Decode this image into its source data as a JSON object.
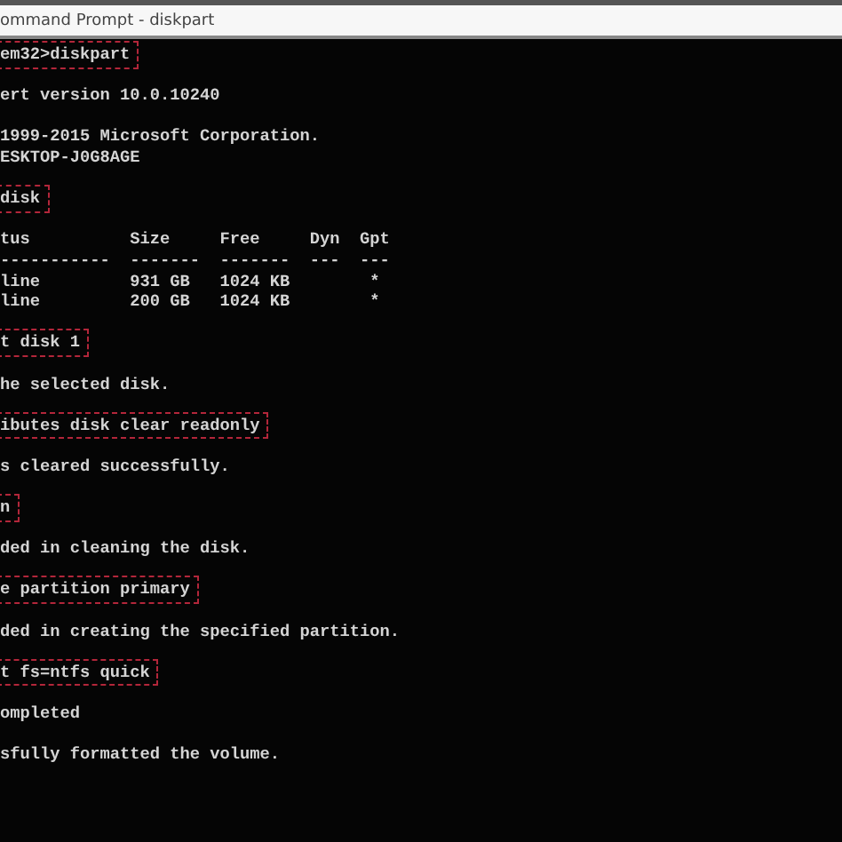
{
  "window": {
    "title": "ommand Prompt - diskpart"
  },
  "console": {
    "blocks": [
      {
        "lines": [
          {
            "kind": "command",
            "text": "em32>diskpart"
          }
        ]
      },
      {
        "lines": [
          {
            "kind": "output",
            "text": "ert version 10.0.10240"
          }
        ]
      },
      {
        "lines": [
          {
            "kind": "output",
            "text": "1999-2015 Microsoft Corporation."
          },
          {
            "kind": "output",
            "text": "ESKTOP-J0G8AGE"
          }
        ]
      },
      {
        "lines": [
          {
            "kind": "command",
            "text": "disk"
          }
        ]
      },
      {
        "lines": [
          {
            "kind": "output",
            "text": "tus          Size     Free     Dyn  Gpt"
          },
          {
            "kind": "output",
            "text": "-----------  -------  -------  ---  ---"
          },
          {
            "kind": "output",
            "text": "line         931 GB   1024 KB        *"
          },
          {
            "kind": "output",
            "text": "line         200 GB   1024 KB        *"
          }
        ]
      },
      {
        "lines": [
          {
            "kind": "command",
            "text": "t disk 1"
          }
        ]
      },
      {
        "lines": [
          {
            "kind": "output",
            "text": "he selected disk."
          }
        ]
      },
      {
        "lines": [
          {
            "kind": "command",
            "text": "ibutes disk clear readonly"
          }
        ]
      },
      {
        "lines": [
          {
            "kind": "output",
            "text": "s cleared successfully."
          }
        ]
      },
      {
        "lines": [
          {
            "kind": "command",
            "text": "n"
          }
        ]
      },
      {
        "lines": [
          {
            "kind": "output",
            "text": "ded in cleaning the disk."
          }
        ]
      },
      {
        "lines": [
          {
            "kind": "command",
            "text": "e partition primary"
          }
        ]
      },
      {
        "lines": [
          {
            "kind": "output",
            "text": "ded in creating the specified partition."
          }
        ]
      },
      {
        "lines": [
          {
            "kind": "command",
            "text": "t fs=ntfs quick"
          }
        ]
      },
      {
        "lines": [
          {
            "kind": "output",
            "text": "ompleted"
          }
        ]
      },
      {
        "lines": [
          {
            "kind": "output",
            "text": "sfully formatted the volume."
          }
        ]
      }
    ]
  }
}
